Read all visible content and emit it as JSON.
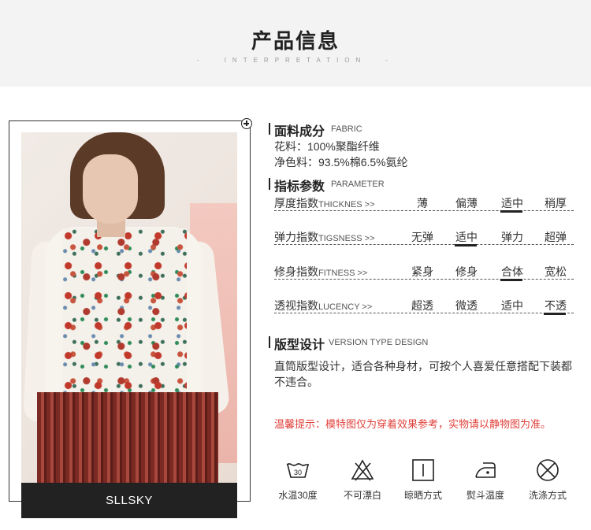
{
  "header": {
    "title": "产品信息",
    "subtitle": "INTERPRETATION",
    "dash_left": "-",
    "dash_right": "-"
  },
  "product": {
    "brand": "SLLSKY"
  },
  "fabric": {
    "title_cn": "面料成分",
    "title_en": "FABRIC",
    "lines": [
      "花料：100%聚酯纤维",
      "净色料：93.5%棉6.5%氨纶"
    ]
  },
  "parameters": {
    "title_cn": "指标参数",
    "title_en": "PARAMETER",
    "rows": [
      {
        "label_cn": "厚度指数",
        "label_en": "THICKNES  >>",
        "options": [
          "薄",
          "偏薄",
          "适中",
          "稍厚"
        ],
        "selected": 2
      },
      {
        "label_cn": "弹力指数",
        "label_en": "TIGSNESS  >>",
        "options": [
          "无弹",
          "适中",
          "弹力",
          "超弹"
        ],
        "selected": 1
      },
      {
        "label_cn": "修身指数",
        "label_en": "FITNESS  >>",
        "options": [
          "紧身",
          "修身",
          "合体",
          "宽松"
        ],
        "selected": 2
      },
      {
        "label_cn": "透视指数",
        "label_en": "LUCENCY  >>",
        "options": [
          "超透",
          "微透",
          "适中",
          "不透"
        ],
        "selected": 3
      }
    ]
  },
  "version": {
    "title_cn": "版型设计",
    "title_en": "VERSION TYPE DESIGN",
    "description": "直筒版型设计，适合各种身材，可按个人喜爱任意搭配下装都不违合。"
  },
  "notice": "温馨提示：模特图仅为穿着效果参考，实物请以静物图为准。",
  "care": [
    {
      "icon": "wash-30-icon",
      "label": "水温30度",
      "symbol_text": "30"
    },
    {
      "icon": "no-bleach-icon",
      "label": "不可漂白"
    },
    {
      "icon": "drip-dry-icon",
      "label": "晾晒方式"
    },
    {
      "icon": "iron-icon",
      "label": "熨斗温度"
    },
    {
      "icon": "no-dry-clean-icon",
      "label": "洗涤方式"
    }
  ],
  "colors": {
    "header_bg": "#f3f3f3",
    "notice": "#e0413b",
    "brand_bar": "#222222"
  }
}
